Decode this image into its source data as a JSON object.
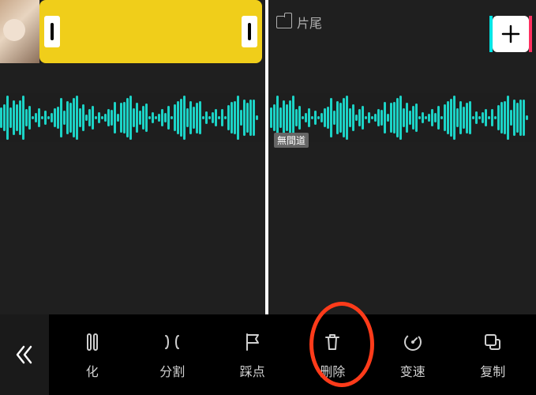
{
  "timeline": {
    "ending_label": "片尾",
    "add_button": "+",
    "audio_name": "無間道"
  },
  "toolbar": {
    "back": "返回",
    "items": [
      {
        "id": "transform",
        "label": "化"
      },
      {
        "id": "split",
        "label": "分割"
      },
      {
        "id": "beat",
        "label": "踩点"
      },
      {
        "id": "delete",
        "label": "删除"
      },
      {
        "id": "speed",
        "label": "变速"
      },
      {
        "id": "copy",
        "label": "复制"
      }
    ]
  },
  "colors": {
    "accent_yellow": "#f0ce1a",
    "waveform": "#1cd3c6",
    "annotation": "#ff3b1a"
  }
}
